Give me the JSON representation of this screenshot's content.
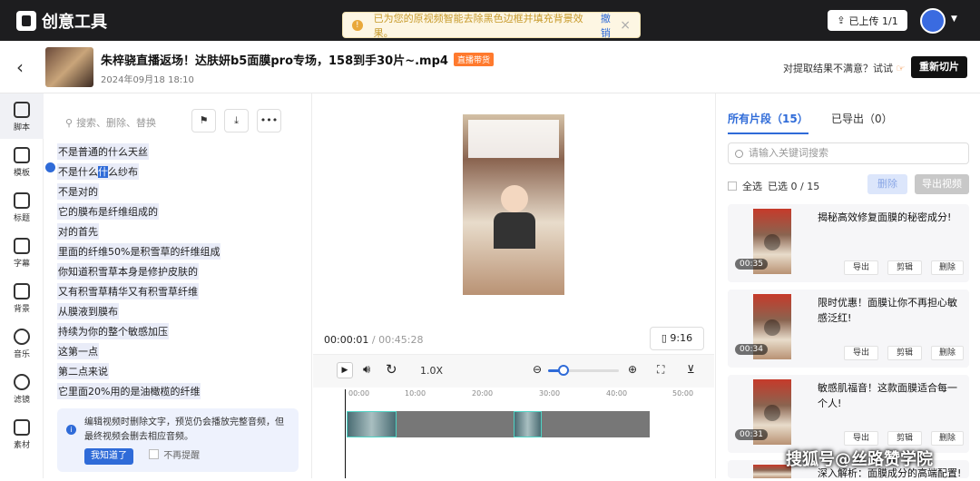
{
  "app": {
    "logo_text": "创意工具"
  },
  "toast": {
    "message": "已为您的原视频智能去除黑色边框并填充背景效果。",
    "undo": "撤销"
  },
  "topbar": {
    "uploaded": "已上传 1/1"
  },
  "video": {
    "title": "朱梓骁直播返场！达肤妍b5面膜pro专场，158到手30片~.mp4",
    "tag": "直播带货",
    "date": "2024年09月18 18:10"
  },
  "header_actions": {
    "unsatisfied": "对提取结果不满意？试试",
    "recut": "重新切片"
  },
  "nav": {
    "items": [
      {
        "label": "脚本",
        "icon": "script-icon"
      },
      {
        "label": "模板",
        "icon": "template-icon"
      },
      {
        "label": "标题",
        "icon": "title-icon"
      },
      {
        "label": "字幕",
        "icon": "subtitle-icon"
      },
      {
        "label": "背景",
        "icon": "background-icon"
      },
      {
        "label": "音乐",
        "icon": "music-icon"
      },
      {
        "label": "滤镜",
        "icon": "filter-icon"
      },
      {
        "label": "素材",
        "icon": "material-icon"
      }
    ]
  },
  "script": {
    "search_placeholder": "搜索、删除、替换",
    "lines": [
      "不是普通的什么天丝",
      "不是什么",
      "不是对的",
      "它的膜布是纤维组成的",
      "对的首先",
      "里面的纤维50%是积雪草的纤维组成",
      "你知道积雪草本身是修护皮肤的",
      "又有积雪草精华又有积雪草纤维",
      "从膜液到膜布",
      "持续为你的整个敏感加压",
      "这第一点",
      "第二点来说",
      "它里面20%用的是油橄榄的纤维"
    ],
    "line2_hl": "什",
    "line2_tail": "么纱布",
    "tip": {
      "text": "编辑视频时删除文字，预览仍会播放完整音频，但最终视频会删去相应音频。",
      "ok": "我知道了",
      "no_remind": "不再提醒"
    }
  },
  "player": {
    "current": "00:00:01",
    "total": "/ 00:45:28",
    "ratio": "9:16",
    "speed": "1.0X",
    "zoom_level": 0.2
  },
  "timeline": {
    "ticks": [
      "00:00",
      "10:00",
      "20:00",
      "30:00",
      "40:00",
      "50:00"
    ]
  },
  "clips_panel": {
    "tab_all": "所有片段（15）",
    "tab_exported": "已导出（0）",
    "search_placeholder": "请输入关键词搜索",
    "select_all": "全选",
    "selected": "已选 0 / 15",
    "delete": "删除",
    "export_video": "导出视频",
    "cards": [
      {
        "duration": "00:35",
        "title": "揭秘高效修复面膜的秘密成分!"
      },
      {
        "duration": "00:34",
        "title": "限时优惠！面膜让你不再担心敏感泛红!"
      },
      {
        "duration": "00:31",
        "title": "敏感肌福音！这款面膜适合每一个人!"
      },
      {
        "duration": "",
        "title": "深入解析：面膜成分的高端配置!"
      }
    ],
    "card_actions": {
      "export": "导出",
      "edit": "剪辑",
      "delete": "删除"
    }
  },
  "watermark": "搜狐号@丝路赞学院"
}
